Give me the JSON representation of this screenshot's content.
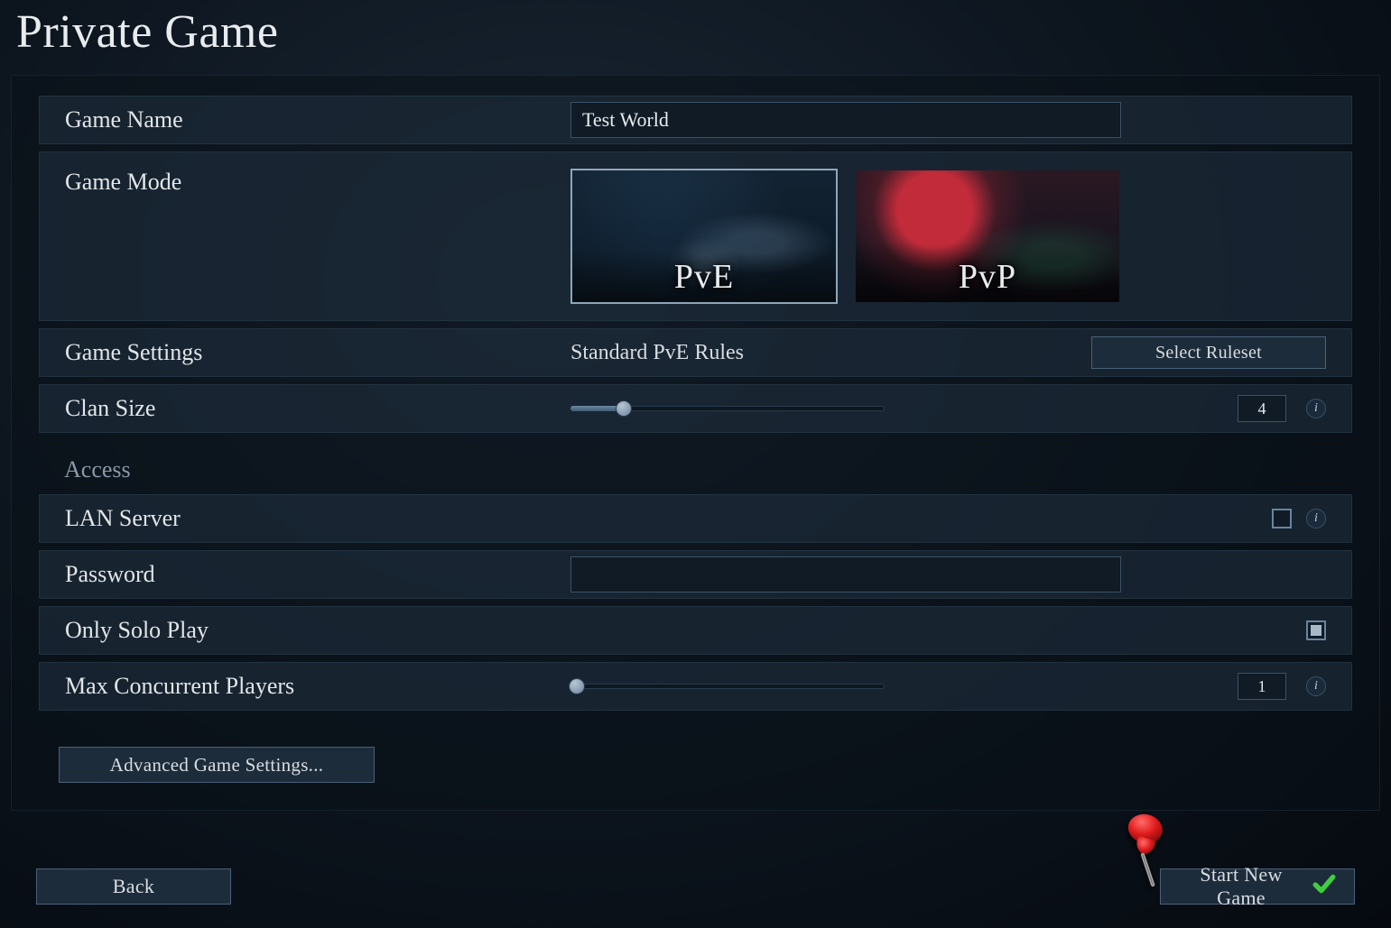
{
  "title": "Private Game",
  "rows": {
    "gameName": {
      "label": "Game Name",
      "value": "Test World"
    },
    "gameMode": {
      "label": "Game Mode",
      "options": [
        {
          "id": "pve",
          "caption": "PvE",
          "selected": true
        },
        {
          "id": "pvp",
          "caption": "PvP",
          "selected": false
        }
      ]
    },
    "gameSettings": {
      "label": "Game Settings",
      "rulesetName": "Standard PvE Rules",
      "buttonLabel": "Select Ruleset"
    },
    "clanSize": {
      "label": "Clan Size",
      "value": 4,
      "min": 1,
      "max": 25,
      "fillPercent": 17,
      "thumbPercent": 17
    },
    "lanServer": {
      "label": "LAN Server",
      "checked": false
    },
    "password": {
      "label": "Password",
      "value": ""
    },
    "onlySolo": {
      "label": "Only Solo Play",
      "checked": true
    },
    "maxPlayers": {
      "label": "Max Concurrent Players",
      "value": 1,
      "min": 1,
      "max": 40,
      "fillPercent": 2,
      "thumbPercent": 2
    }
  },
  "accessHeading": "Access",
  "buttons": {
    "advanced": "Advanced Game Settings...",
    "back": "Back",
    "start": "Start New Game"
  },
  "icons": {
    "info": "i",
    "check": "✓"
  }
}
